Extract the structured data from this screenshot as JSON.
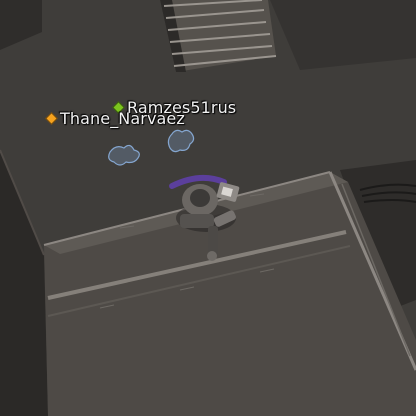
{
  "players": [
    {
      "name": "Ramzes51rus",
      "marker_color": "#7cc41f"
    },
    {
      "name": "Thane_Narvaez",
      "marker_color": "#f5a21e"
    }
  ],
  "colors": {
    "floor": "#3f3d3a",
    "wall": "#2b2927",
    "platform": "#4e4a46",
    "trim": "#8c8782",
    "hologram": "#8fb6e6",
    "character_accent": "#5b3f9c"
  }
}
